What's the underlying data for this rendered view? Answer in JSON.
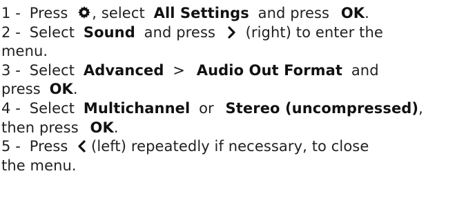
{
  "steps": [
    {
      "number": "1 -",
      "press": "Press",
      "icon": "settings-gear-icon",
      "after_icon": ", select",
      "target": "All Settings",
      "mid": "and press",
      "key": "OK",
      "end": "."
    },
    {
      "number": "2 -",
      "select": "Select",
      "target": "Sound",
      "mid": "and press",
      "icon": "chevron-right-icon",
      "direction": "(right) to enter the",
      "cont": "menu."
    },
    {
      "number": "3 -",
      "select": "Select",
      "target": "Advanced",
      "sep": ">",
      "target2": "Audio Out Format",
      "mid": "and",
      "cont_press": "press",
      "key": "OK",
      "end": "."
    },
    {
      "number": "4 -",
      "select": "Select",
      "target": "Multichannel",
      "or": "or",
      "target2": "Stereo (uncompressed)",
      "comma": ",",
      "cont_then": "then press",
      "key": "OK",
      "end": "."
    },
    {
      "number": "5 -",
      "press": "Press",
      "icon": "chevron-left-icon",
      "direction": "(left) repeatedly if necessary, to close",
      "cont": "the menu."
    }
  ]
}
